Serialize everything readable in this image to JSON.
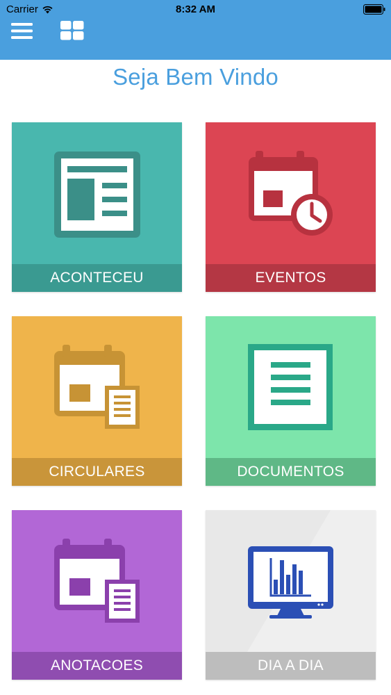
{
  "status_bar": {
    "carrier": "Carrier",
    "time": "8:32 AM"
  },
  "header": {
    "menu_icon": "hamburger-menu-icon",
    "grid_icon": "grid-view-icon",
    "background_color": "#4a9fde"
  },
  "welcome_title": "Seja Bem Vindo",
  "tiles": [
    {
      "label": "ACONTECEU",
      "icon": "newspaper-icon",
      "color": "#49b7ae",
      "label_color": "#3a9a91"
    },
    {
      "label": "EVENTOS",
      "icon": "calendar-clock-icon",
      "color": "#dc4553",
      "label_color": "#b43744"
    },
    {
      "label": "CIRCULARES",
      "icon": "calendar-document-icon",
      "color": "#efb44b",
      "label_color": "#c9953a"
    },
    {
      "label": "DOCUMENTOS",
      "icon": "document-list-icon",
      "color": "#7de5ab",
      "label_color": "#5fb886"
    },
    {
      "label": "ANOTACOES",
      "icon": "calendar-note-icon",
      "color": "#b267d6",
      "label_color": "#8f4db0"
    },
    {
      "label": "DIA A DIA",
      "icon": "monitor-chart-icon",
      "color": "#e8e8e8",
      "label_color": "#bdbdbd"
    }
  ]
}
